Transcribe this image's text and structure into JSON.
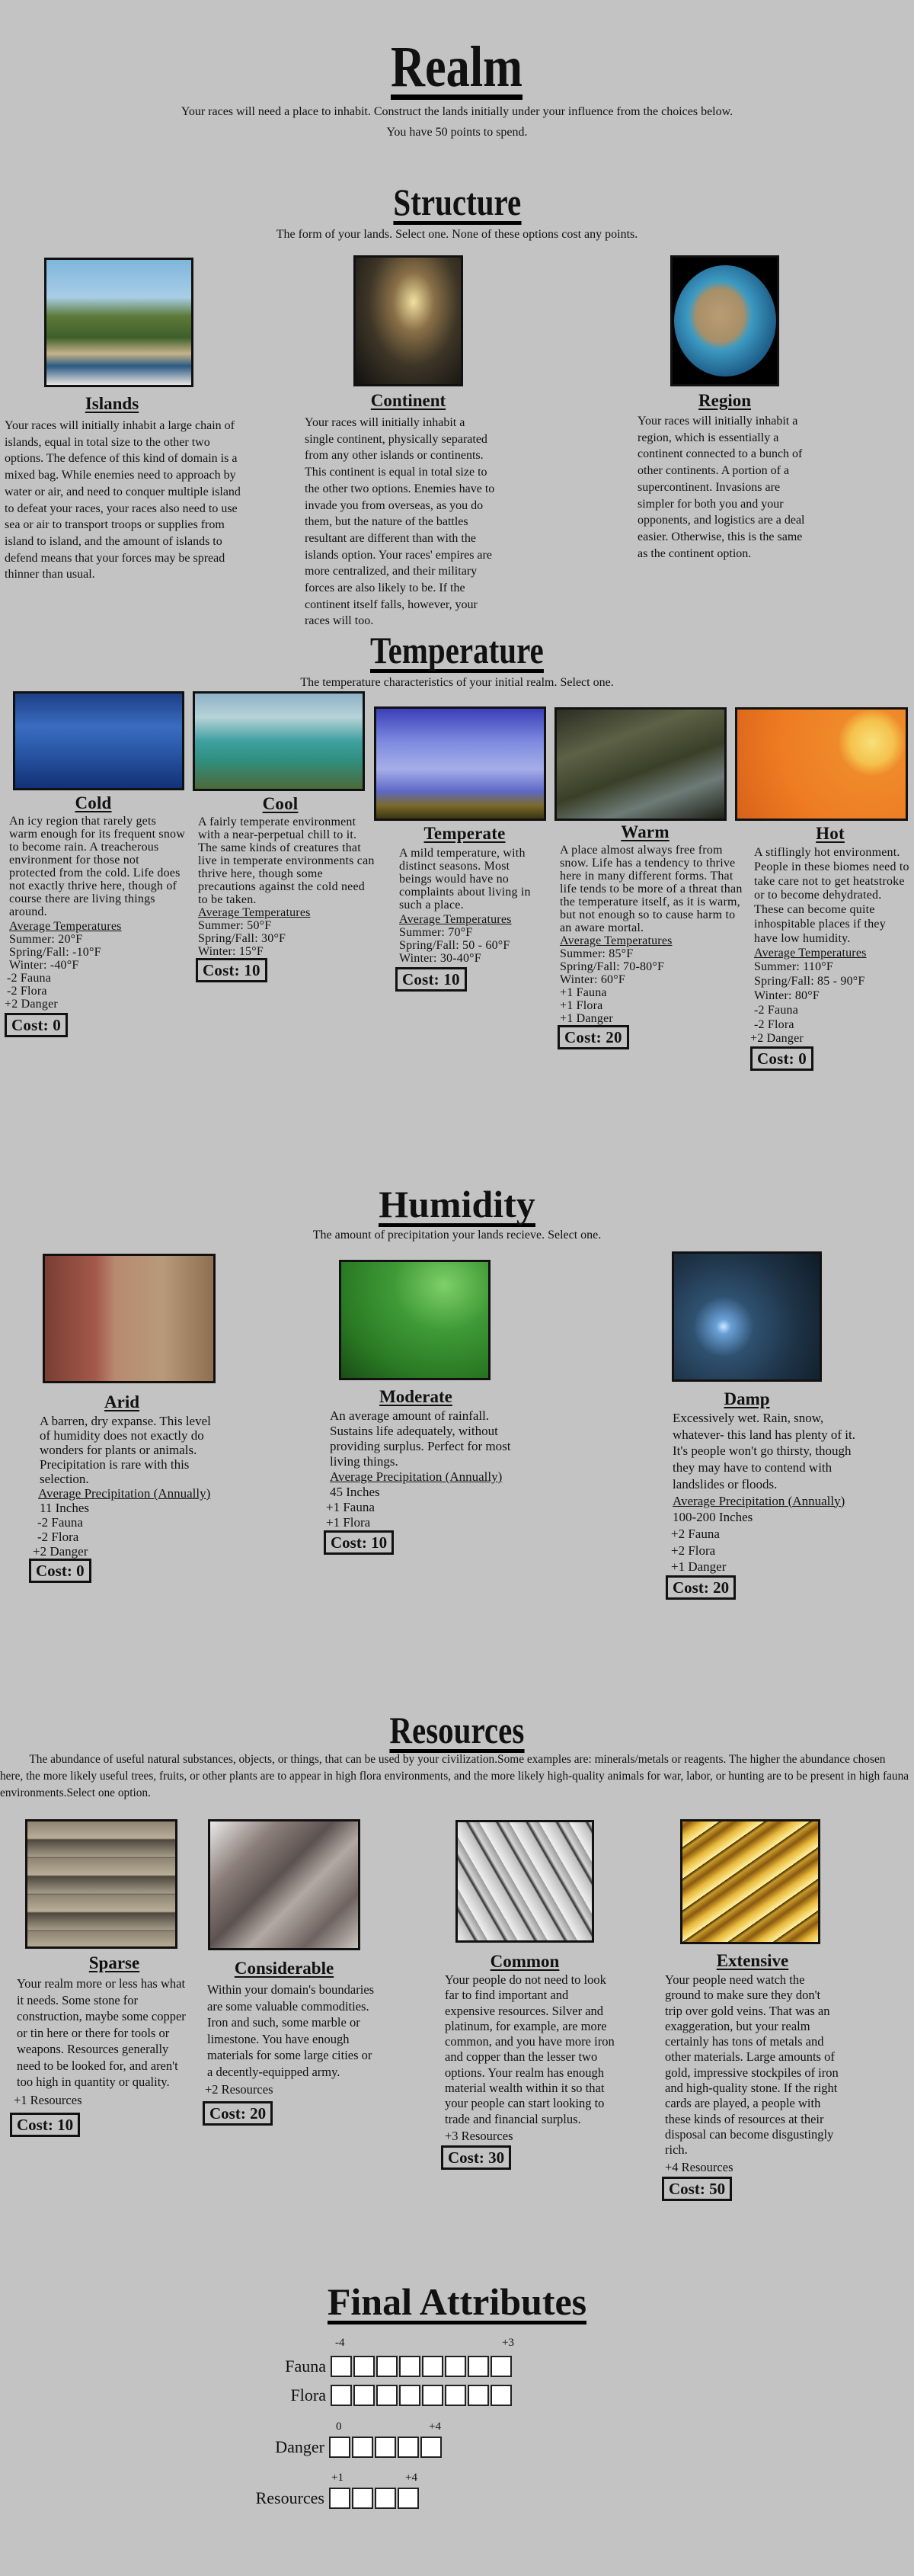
{
  "page": {
    "title": "Realm",
    "intro_line1": "Your races will need a place to inhabit. Construct the lands initially under your influence from the choices below.",
    "intro_line2": "You have 50 points to spend."
  },
  "structure": {
    "title": "Structure",
    "subtitle": "The form of your lands. Select one. None of these options cost any points.",
    "options": [
      {
        "name": "Islands",
        "image": "floating-island-city-image",
        "description": "Your races will initially inhabit a large chain of islands, equal in total size to the other two options. The defence of this kind of domain is a mixed bag. While enemies need to approach by water or air, and need to conquer multiple island to defeat your races, your races also need to use sea or air to transport troops or supplies from island to island, and the amount of islands to defend means that your forces may be spread thinner than usual."
      },
      {
        "name": "Continent",
        "image": "floating-continent-waterfalls-image",
        "description": "Your races will initially inhabit a single continent, physically separated from any other islands or continents. This continent is equal in total size to the other two options. Enemies have to invade you from overseas, as you do them, but the nature of the battles resultant are different than with the islands option. Your races' empires are more centralized, and their military forces are also likely to be. If the continent itself falls, however, your races will too."
      },
      {
        "name": "Region",
        "image": "supercontinent-globe-image",
        "description": "Your races will initially inhabit a region, which is essentially a continent connected to a bunch of other continents. A portion of a supercontinent. Invasions are simpler for both you and your opponents, and logistics are a deal easier. Otherwise, this is the same as the continent option."
      }
    ]
  },
  "temperature": {
    "title": "Temperature",
    "subtitle": "The temperature characteristics of your initial realm. Select one.",
    "stats_heading": "Average Temperatures",
    "options": [
      {
        "name": "Cold",
        "image": "ice-landscape-image",
        "description": "An icy region that rarely gets warm enough for its frequent snow to become rain. A treacherous environment for those not protected from the cold. Life does not exactly thrive here, though of course there are living things around.",
        "summer": "Summer: 20°F",
        "spring_fall": "Spring/Fall: -10°F",
        "winter": "Winter: -40°F",
        "modifiers": [
          "-2 Fauna",
          "-2 Flora",
          "+2 Danger"
        ],
        "cost": "Cost: 0"
      },
      {
        "name": "Cool",
        "image": "mountain-pine-painting-image",
        "description": "A fairly temperate environment with a near-perpetual chill to it. The same kinds of creatures that live in temperate environments can thrive here, though some precautions against the cold need to be taken.",
        "summer": "Summer: 50°F",
        "spring_fall": "Spring/Fall: 30°F",
        "winter": "Winter: 15°F",
        "modifiers": [],
        "cost": "Cost: 10"
      },
      {
        "name": "Temperate",
        "image": "cloudy-sky-plains-image",
        "description": "A mild temperature, with distinct seasons. Most beings would have no complaints about living in such a place.",
        "summer": "Summer: 70°F",
        "spring_fall": "Spring/Fall: 50 - 60°F",
        "winter": "Winter: 30-40°F",
        "modifiers": [],
        "cost": "Cost: 10"
      },
      {
        "name": "Warm",
        "image": "jungle-river-image",
        "description": "A place almost always free from snow. Life has a tendency to thrive here in many different forms. That life tends to be more of a threat than the temperature itself, as it is warm, but not enough so to cause harm to an aware mortal.",
        "summer": "Summer: 85°F",
        "spring_fall": "Spring/Fall: 70-80°F",
        "winter": "Winter: 60°F",
        "modifiers": [
          "+1 Fauna",
          "+1 Flora",
          "+1 Danger"
        ],
        "cost": "Cost: 20"
      },
      {
        "name": "Hot",
        "image": "desert-sun-plant-image",
        "description": "A stiflingly hot environment. People in these biomes need to take care not to get heatstroke or to become dehydrated. These can become quite inhospitable places if they have low humidity.",
        "summer": "Summer: 110°F",
        "spring_fall": "Spring/Fall: 85  - 90°F",
        "winter": "Winter: 80°F",
        "modifiers": [
          "-2 Fauna",
          "-2 Flora",
          "+2 Danger"
        ],
        "cost": "Cost: 0"
      }
    ]
  },
  "humidity": {
    "title": "Humidity",
    "subtitle": "The amount of precipitation your lands recieve. Select one.",
    "stats_heading": "Average Precipitation (Annually)",
    "options": [
      {
        "name": "Arid",
        "image": "cracked-earth-image",
        "description": "A barren, dry expanse. This level of humidity does not exactly do wonders for plants or animals. Precipitation is rare with this selection.",
        "amount": "11 Inches",
        "modifiers": [
          "-2 Fauna",
          "-2 Flora",
          "+2 Danger"
        ],
        "cost": "Cost: 0"
      },
      {
        "name": "Moderate",
        "image": "leaf-water-droplets-image",
        "description": "An average amount of rainfall. Sustains life adequately, without providing surplus. Perfect for most living things.",
        "amount": "45 Inches",
        "modifiers": [
          "+1 Fauna",
          "+1 Flora"
        ],
        "cost": "Cost: 10"
      },
      {
        "name": "Damp",
        "image": "rainy-night-bridge-image",
        "description": "Excessively wet. Rain, snow, whatever- this land has plenty of it. It's people won't go thirsty, though they may have to contend with landslides or floods.",
        "amount": "100-200 Inches",
        "modifiers": [
          "+2 Fauna",
          "+2 Flora",
          "+1 Danger"
        ],
        "cost": "Cost: 20"
      }
    ]
  },
  "resources": {
    "title": "Resources",
    "subtitle": "The abundance of useful natural substances, objects, or things, that can be used by your civilization.Some examples are: minerals/metals or reagents. The higher the abundance chosen here, the more likely useful trees, fruits, or other plants are to appear in high flora environments, and the more likely high-quality animals for war, labor, or hunting are to be present in high fauna environments.Select one option.",
    "options": [
      {
        "name": "Sparse",
        "image": "stone-wall-image",
        "description": "Your realm more or less has what it needs. Some stone for construction, maybe some copper or tin here or there for tools or weapons. Resources generally need to be looked for, and aren't too high in quantity or quality.",
        "modifier": "+1 Resources",
        "cost": "Cost: 10"
      },
      {
        "name": "Considerable",
        "image": "iron-ingots-image",
        "description": "Within your domain's boundaries are some valuable commodities. Iron and such, some marble or limestone. You have enough materials for some large cities or a decently-equipped army.",
        "modifier": "+2 Resources",
        "cost": "Cost: 20"
      },
      {
        "name": "Common",
        "image": "silver-bars-image",
        "description": "Your people do not need to look far to find important and expensive resources. Silver and platinum, for example, are more common, and you have more iron and copper than the lesser two options. Your realm has enough material wealth within it so that your people can start looking to trade and financial surplus.",
        "modifier": "+3 Resources",
        "cost": "Cost: 30"
      },
      {
        "name": "Extensive",
        "image": "gold-bars-image",
        "description": "Your people need watch the ground to make sure they don't trip over gold veins. That was an exaggeration, but your realm certainly has tons of metals and other materials. Large amounts of gold, impressive stockpiles of iron and high-quality stone. If the right cards are played, a people with these kinds of resources at their disposal can become disgustingly rich.",
        "modifier": "+4 Resources",
        "cost": "Cost: 50"
      }
    ]
  },
  "final_attributes": {
    "title": "Final Attributes",
    "rows": [
      {
        "label": "Fauna",
        "min": "-4",
        "max": "+3",
        "boxes": 8
      },
      {
        "label": "Flora",
        "min": "",
        "max": "",
        "boxes": 8
      },
      {
        "label": "Danger",
        "min": "0",
        "max": "+4",
        "boxes": 5
      },
      {
        "label": "Resources",
        "min": "+1",
        "max": "+4",
        "boxes": 4
      }
    ]
  }
}
